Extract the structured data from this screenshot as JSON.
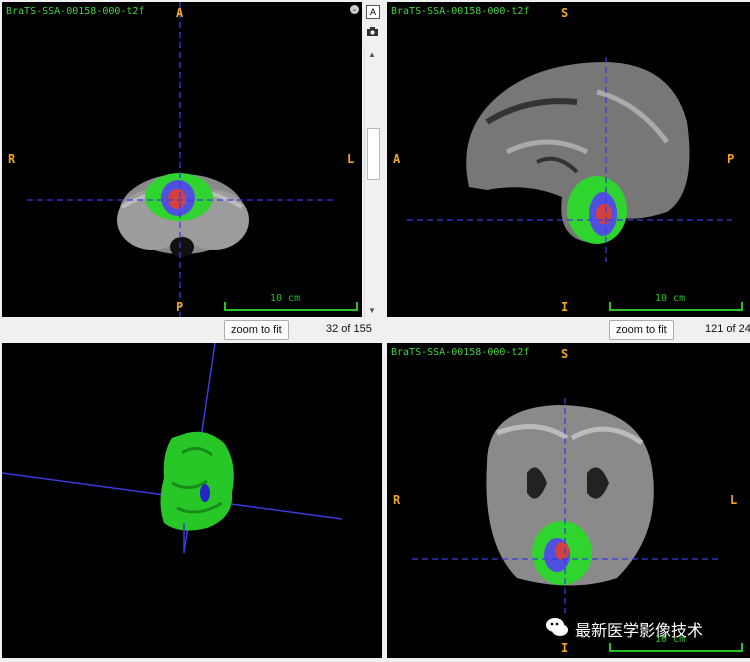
{
  "app": {
    "accent_orange": "#f2a61c",
    "accent_green": "#25c225",
    "crosshair_color": "#3a3adf"
  },
  "views": {
    "axial": {
      "filename": "BraTS-SSA-00158-000-t2f",
      "top": "A",
      "bottom": "P",
      "left": "R",
      "right": "L",
      "scale_label": "10 cm",
      "zoom_button": "zoom to fit",
      "slice_text": "32 of 155"
    },
    "sagittal": {
      "filename": "BraTS-SSA-00158-000-t2f",
      "top": "S",
      "bottom": "I",
      "left": "A",
      "right": "P",
      "scale_label": "10 cm",
      "zoom_button": "zoom to fit",
      "slice_text": "121 of 24"
    },
    "render3d": {},
    "coronal": {
      "filename": "BraTS-SSA-00158-000-t2f",
      "top": "S",
      "bottom": "I",
      "left": "R",
      "right": "L",
      "scale_label": "10 cm"
    }
  },
  "side_tools": {
    "layout_icon": "A",
    "camera_icon": "camera-icon",
    "collapse_icon": "chevron-down-icon"
  },
  "watermark": {
    "text": "最新医学影像技术",
    "icon": "wechat-icon"
  }
}
